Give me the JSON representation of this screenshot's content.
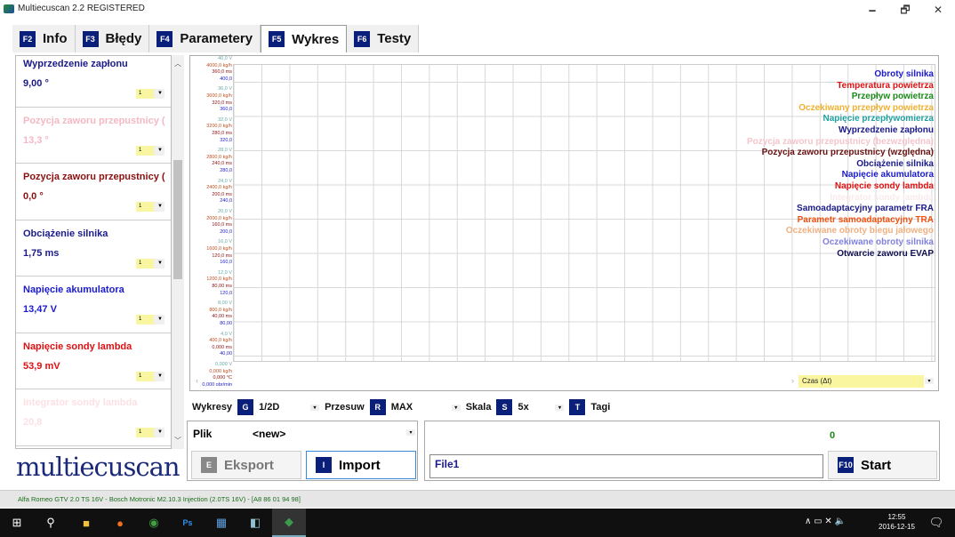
{
  "window": {
    "title": "Multiecuscan 2.2 REGISTERED",
    "minimize": "🗕",
    "maximize": "🗗",
    "close": "✕"
  },
  "tabs": [
    {
      "key": "F2",
      "label": "Info"
    },
    {
      "key": "F3",
      "label": "Błędy"
    },
    {
      "key": "F4",
      "label": "Parametery"
    },
    {
      "key": "F5",
      "label": "Wykres",
      "active": true
    },
    {
      "key": "F6",
      "label": "Testy"
    }
  ],
  "parameters": [
    {
      "name": "Wyprzedzenie zapłonu",
      "value": "9,00 °",
      "color": "#1a1a8a",
      "scale": "1"
    },
    {
      "name": "Pozycja zaworu przepustnicy (",
      "value": "13,3 °",
      "color": "#f4b8c4",
      "scale": "1"
    },
    {
      "name": "Pozycja zaworu przepustnicy (",
      "value": "0,0 °",
      "color": "#8b1010",
      "scale": "1"
    },
    {
      "name": "Obciążenie silnika",
      "value": "1,75 ms",
      "color": "#1a1a8a",
      "scale": "1"
    },
    {
      "name": "Napięcie akumulatora",
      "value": "13,47 V",
      "color": "#1a1ad0",
      "scale": "1"
    },
    {
      "name": "Napięcie sondy lambda",
      "value": "53,9 mV",
      "color": "#e01010",
      "scale": "1"
    },
    {
      "name": "Integrator sondy lambda",
      "value": "20,8",
      "color": "#fbe0e4",
      "scale": "1"
    }
  ],
  "yaxis": {
    "rpm": [
      "400,0",
      "360,0",
      "320,0",
      "280,0",
      "240,0",
      "200,0",
      "160,0",
      "120,0",
      "80,00",
      "40,00",
      "0,000 obr/min"
    ],
    "volts": [
      "40,0 V",
      "36,0 V",
      "32,0 V",
      "28,0 V",
      "24,0 V",
      "20,0 V",
      "16,0 V",
      "12,0 V",
      "8,00 V",
      "4,0 V",
      "0,000 V"
    ],
    "kgh": [
      "4000,0 kg/h",
      "3600,0 kg/h",
      "3200,0 kg/h",
      "2800,0 kg/h",
      "2400,0 kg/h",
      "2000,0 kg/h",
      "1600,0 kg/h",
      "1200,0 kg/h",
      "800,0 kg/h",
      "400,0 kg/h",
      "0,000 kg/h"
    ],
    "ms": [
      "360,0 ms",
      "320,0 ms",
      "280,0 ms",
      "240,0 ms",
      "200,0 ms",
      "160,0 ms",
      "120,0 ms",
      "80,00 ms",
      "40,00 ms",
      "0,000 ms",
      "0,000 °C"
    ]
  },
  "legend": [
    {
      "label": "Obroty silnika",
      "color": "#1a1ad0"
    },
    {
      "label": "Temperatura powietrza",
      "color": "#e01010"
    },
    {
      "label": "Przepływ powietrza",
      "color": "#1a8a1a"
    },
    {
      "label": "Oczekiwany przepływ powietrza",
      "color": "#f0b030"
    },
    {
      "label": "Napięcie przepływomierza",
      "color": "#20a0a0"
    },
    {
      "label": "Wyprzedzenie zapłonu",
      "color": "#1a1a8a"
    },
    {
      "label": "Pozycja zaworu przepustnicy (bezwzględna)",
      "color": "#f4c4cc"
    },
    {
      "label": "Pozycja zaworu przepustnicy (względna)",
      "color": "#6a1010"
    },
    {
      "label": "Obciążenie silnika",
      "color": "#1a1a8a"
    },
    {
      "label": "Napięcie akumulatora",
      "color": "#1a1ad0"
    },
    {
      "label": "Napięcie sondy lambda",
      "color": "#e01010"
    },
    {
      "label": "Integrator sondy lambda",
      "color": "#fbeaec"
    },
    {
      "label": "Samoadaptacyjny parametr FRA",
      "color": "#1a1a8a"
    },
    {
      "label": "Parametr samoadaptacyjny TRA",
      "color": "#f05010"
    },
    {
      "label": "Oczekiwane obroty biegu jałowego",
      "color": "#f0b080"
    },
    {
      "label": "Oczekiwane obroty silnika",
      "color": "#8080e0"
    },
    {
      "label": "Otwarcie zaworu EVAP",
      "color": "#101050"
    }
  ],
  "time_axis": "Czas (Δt)",
  "controls": {
    "wykresy_label": "Wykresy",
    "wykresy_key": "G",
    "wykresy_value": "1/2D",
    "przesuw_label": "Przesuw",
    "przesuw_key": "R",
    "przesuw_value": "MAX",
    "skala_label": "Skala",
    "skala_key": "S",
    "skala_value": "5x",
    "tagi_key": "T",
    "tagi_label": "Tagi"
  },
  "file": {
    "label": "Plik",
    "value": "<new>",
    "export_key": "E",
    "export_label": "Eksport",
    "import_key": "I",
    "import_label": "Import"
  },
  "record": {
    "counter": "0",
    "filename": "File1",
    "start_key": "F10",
    "start_label": "Start"
  },
  "logo": "multiecuscan",
  "status": {
    "vehicle": "Alfa Romeo GTV 2.0 TS 16V - Bosch Motronic M2.10.3 Injection (2.0TS 16V) - [A8 86 01 94 98]"
  },
  "taskbar": {
    "time": "12:55",
    "date": "2016-12-15"
  }
}
